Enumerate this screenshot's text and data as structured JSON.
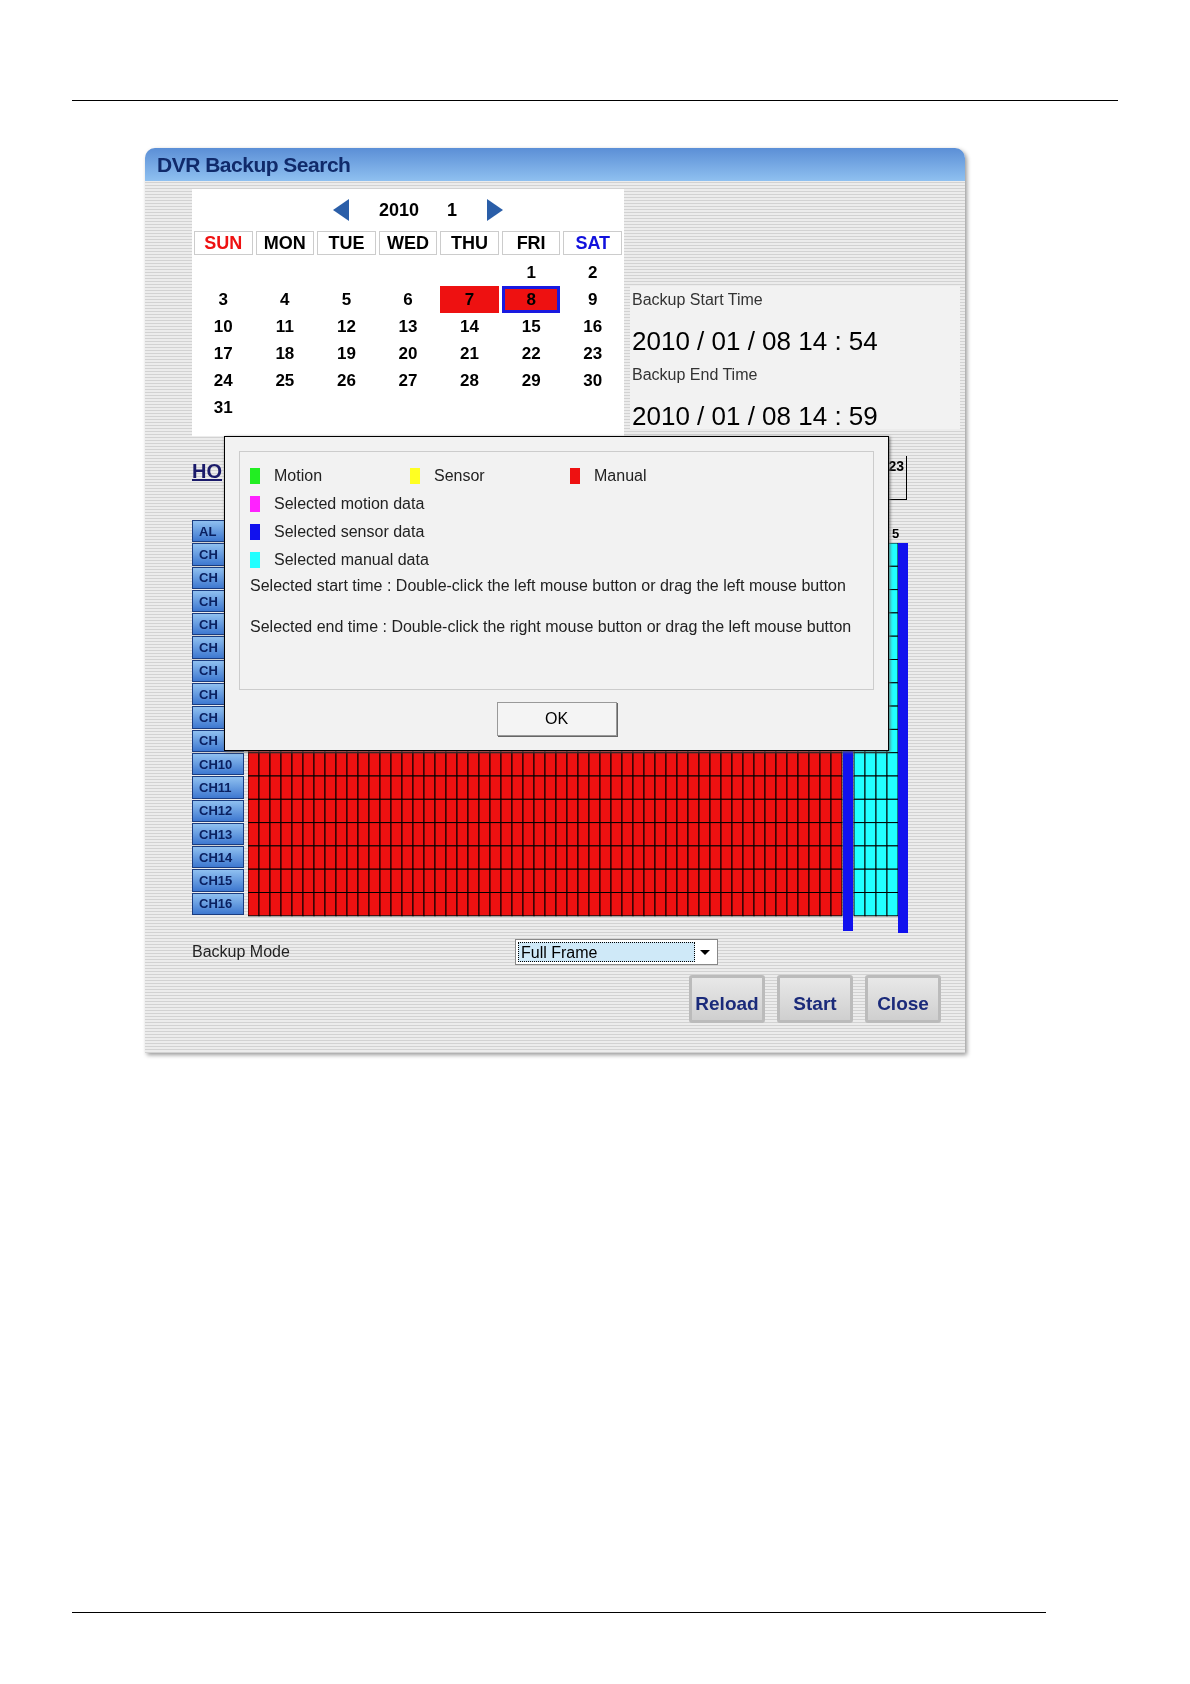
{
  "window": {
    "title": "DVR Backup Search"
  },
  "calendar": {
    "year": "2010",
    "month": "1",
    "weekdays": [
      {
        "label": "SUN",
        "kind": "sunday"
      },
      {
        "label": "MON",
        "kind": "weekday"
      },
      {
        "label": "TUE",
        "kind": "weekday"
      },
      {
        "label": "WED",
        "kind": "weekday"
      },
      {
        "label": "THU",
        "kind": "weekday"
      },
      {
        "label": "FRI",
        "kind": "weekday"
      },
      {
        "label": "SAT",
        "kind": "saturday"
      }
    ],
    "weeks": [
      [
        {
          "label": "1",
          "recorded": false,
          "selected": false
        },
        {
          "label": "2",
          "recorded": false,
          "selected": false
        }
      ],
      [
        {
          "label": "3",
          "recorded": false,
          "selected": false
        },
        {
          "label": "4",
          "recorded": false,
          "selected": false
        },
        {
          "label": "5",
          "recorded": false,
          "selected": false
        },
        {
          "label": "6",
          "recorded": false,
          "selected": false
        },
        {
          "label": "7",
          "recorded": true,
          "selected": false
        },
        {
          "label": "8",
          "recorded": true,
          "selected": true
        },
        {
          "label": "9",
          "recorded": false,
          "selected": false
        }
      ],
      [
        {
          "label": "10",
          "recorded": false,
          "selected": false
        },
        {
          "label": "11",
          "recorded": false,
          "selected": false
        },
        {
          "label": "12",
          "recorded": false,
          "selected": false
        },
        {
          "label": "13",
          "recorded": false,
          "selected": false
        },
        {
          "label": "14",
          "recorded": false,
          "selected": false
        },
        {
          "label": "15",
          "recorded": false,
          "selected": false
        },
        {
          "label": "16",
          "recorded": false,
          "selected": false
        }
      ],
      [
        {
          "label": "17",
          "recorded": false,
          "selected": false
        },
        {
          "label": "18",
          "recorded": false,
          "selected": false
        },
        {
          "label": "19",
          "recorded": false,
          "selected": false
        },
        {
          "label": "20",
          "recorded": false,
          "selected": false
        },
        {
          "label": "21",
          "recorded": false,
          "selected": false
        },
        {
          "label": "22",
          "recorded": false,
          "selected": false
        },
        {
          "label": "23",
          "recorded": false,
          "selected": false
        }
      ],
      [
        {
          "label": "24",
          "recorded": false,
          "selected": false
        },
        {
          "label": "25",
          "recorded": false,
          "selected": false
        },
        {
          "label": "26",
          "recorded": false,
          "selected": false
        },
        {
          "label": "27",
          "recorded": false,
          "selected": false
        },
        {
          "label": "28",
          "recorded": false,
          "selected": false
        },
        {
          "label": "29",
          "recorded": false,
          "selected": false
        },
        {
          "label": "30",
          "recorded": false,
          "selected": false
        }
      ],
      [
        {
          "label": "31",
          "recorded": false,
          "selected": false
        }
      ]
    ]
  },
  "backup_time": {
    "start_label": "Backup Start Time",
    "start_value": "2010 / 01 / 08 14 : 54",
    "end_label": "Backup End Time",
    "end_value": "2010 / 01 / 08 14 : 59"
  },
  "timeline": {
    "hours_label": "HO",
    "last_hour": "23",
    "hour_mark": "5",
    "channels": [
      {
        "label": "AL"
      },
      {
        "label": "CH"
      },
      {
        "label": "CH"
      },
      {
        "label": "CH"
      },
      {
        "label": "CH"
      },
      {
        "label": "CH"
      },
      {
        "label": "CH"
      },
      {
        "label": "CH"
      },
      {
        "label": "CH"
      },
      {
        "label": "CH"
      },
      {
        "label": "CH10"
      },
      {
        "label": "CH11"
      },
      {
        "label": "CH12"
      },
      {
        "label": "CH13"
      },
      {
        "label": "CH14"
      },
      {
        "label": "CH15"
      },
      {
        "label": "CH16"
      }
    ]
  },
  "dialog": {
    "legend_row": [
      {
        "label": "Motion",
        "color": "#22ee22"
      },
      {
        "label": "Sensor",
        "color": "#ffff22"
      },
      {
        "label": "Manual",
        "color": "#ee1111"
      }
    ],
    "legend_list": [
      {
        "label": "Selected motion data",
        "color": "#ff22ff"
      },
      {
        "label": "Selected sensor data",
        "color": "#1111ee"
      },
      {
        "label": "Selected manual data",
        "color": "#22ffff"
      }
    ],
    "notes": [
      "Selected start time : Double-click the left mouse button or drag the left mouse button",
      "Selected end time : Double-click the right mouse button or drag the left mouse button"
    ],
    "ok_button": "OK"
  },
  "backup_mode": {
    "label": "Backup Mode",
    "value": "Full Frame"
  },
  "buttons": [
    "Reload",
    "Start",
    "Close"
  ]
}
